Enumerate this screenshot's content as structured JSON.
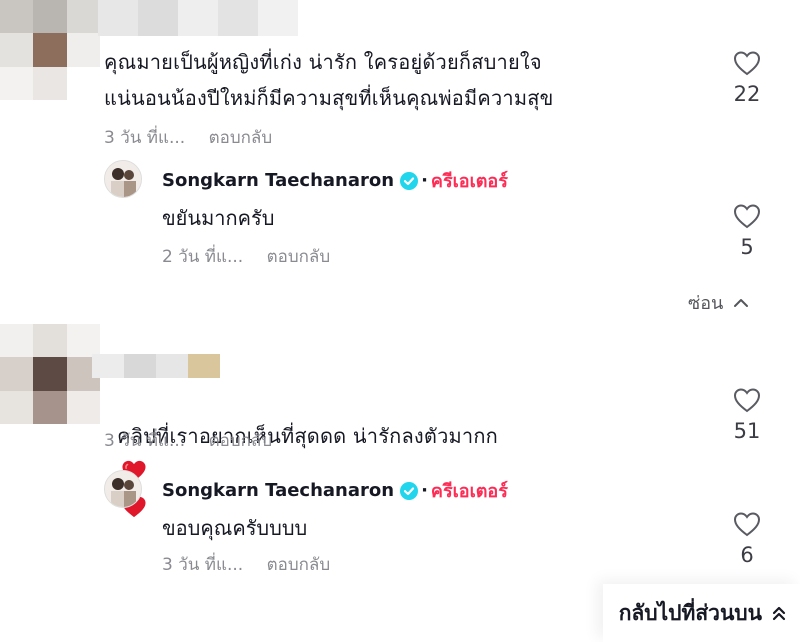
{
  "comments": [
    {
      "text": "คุณมายเป็นผู้หญิงที่เก่ง น่ารัก ใครอยู่ด้วยก็สบายใจ\nแน่นอนน้องปีใหม่ก็มีความสุขที่เห็นคุณพ่อมีความสุข",
      "time": "3 วัน ที่แ...",
      "reply_label": "ตอบกลับ",
      "likes": "22",
      "reply": {
        "author": "Songkarn Taechanaron",
        "badge": "ครีเอเตอร์",
        "text": "ขยันมากครับ",
        "time": "2 วัน ที่แ...",
        "reply_label": "ตอบกลับ",
        "likes": "5"
      },
      "hide_label": "ซ่อน"
    },
    {
      "text": "คลิปที่เราอยากเห็นที่สุดดด น่ารักลงตัวมากก",
      "time": "3 วัน ที่แ...",
      "reply_label": "ตอบกลับ",
      "likes": "51",
      "reply": {
        "author": "Songkarn Taechanaron",
        "badge": "ครีเอเตอร์",
        "text": "ขอบคุณครับบบบ",
        "time": "3 วัน ที่แ...",
        "reply_label": "ตอบกลับ",
        "likes": "6"
      }
    }
  ],
  "back_to_top": "กลับไปที่ส่วนบน",
  "colors": {
    "accent": "#fe2c55",
    "verified": "#20d5ec",
    "muted": "#8a8b91"
  }
}
